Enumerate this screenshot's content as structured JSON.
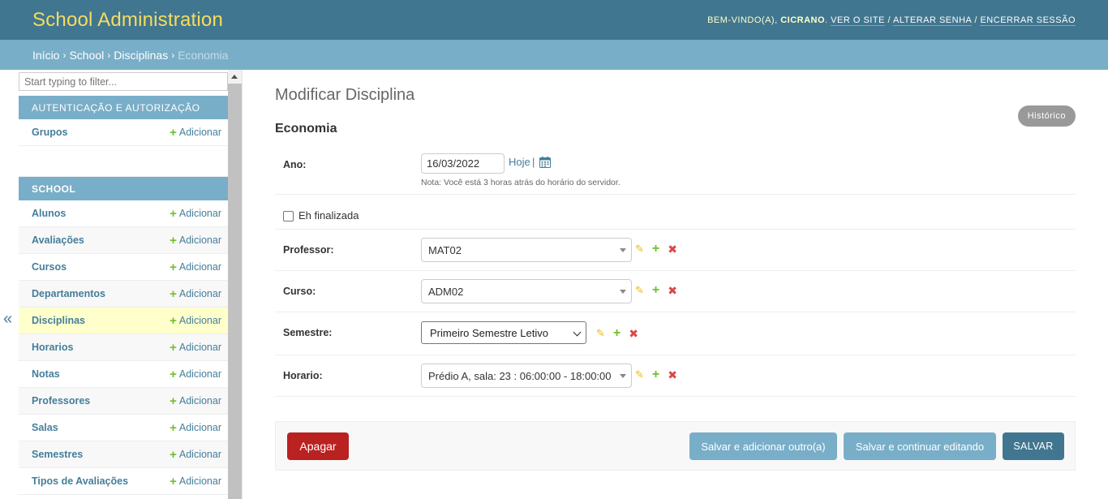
{
  "header": {
    "site_name": "School Administration",
    "welcome": "Bem-vindo(a),",
    "username": "Cicrano",
    "view_site": "Ver o site",
    "change_password": "Alterar senha",
    "logout": "Encerrar sessão",
    "separator": "/"
  },
  "breadcrumbs": {
    "items": [
      "Início",
      "School",
      "Disciplinas"
    ],
    "current": "Economia",
    "separator": "›"
  },
  "sidebar": {
    "filter_placeholder": "Start typing to filter...",
    "collapse_glyph": "«",
    "add_label": "Adicionar",
    "modules": [
      {
        "caption": "Autenticação e Autorização",
        "models": [
          "Grupos"
        ]
      },
      {
        "caption": "School",
        "models": [
          "Alunos",
          "Avaliações",
          "Cursos",
          "Departamentos",
          "Disciplinas",
          "Horarios",
          "Notas",
          "Professores",
          "Salas",
          "Semestres",
          "Tipos de Avaliações"
        ],
        "current": "Disciplinas"
      }
    ]
  },
  "content": {
    "title": "Modificar Disciplina",
    "object_name": "Economia",
    "history_button": "Histórico",
    "fields": {
      "ano": {
        "label": "Ano:",
        "value": "16/03/2022",
        "today_link": "Hoje",
        "today_sep": "|",
        "note": "Nota: Você está 3 horas atrás do horário do servidor."
      },
      "finalizada": {
        "label": "Eh finalizada",
        "checked": false
      },
      "professor": {
        "label": "Professor:",
        "value": "MAT02"
      },
      "curso": {
        "label": "Curso:",
        "value": "ADM02"
      },
      "semestre": {
        "label": "Semestre:",
        "value": "Primeiro Semestre Letivo"
      },
      "horario": {
        "label": "Horario:",
        "value": "Prédio A, sala: 23 : 06:00:00 - 18:00:00"
      }
    },
    "buttons": {
      "delete": "Apagar",
      "save_add_another": "Salvar e adicionar outro(a)",
      "save_continue": "Salvar e continuar editando",
      "save": "SALVAR"
    }
  },
  "colors": {
    "header_bg": "#417690",
    "brand": "#f5dd5d",
    "breadcrumbs_bg": "#79aec8",
    "link": "#447e9b",
    "add_green": "#70bf2b",
    "delete_red": "#ba2121",
    "current_row": "#ffffcc"
  },
  "icons": [
    "plus-icon",
    "pencil-icon",
    "delete-icon",
    "calendar-icon",
    "chevron-down-icon",
    "collapse-icon"
  ]
}
